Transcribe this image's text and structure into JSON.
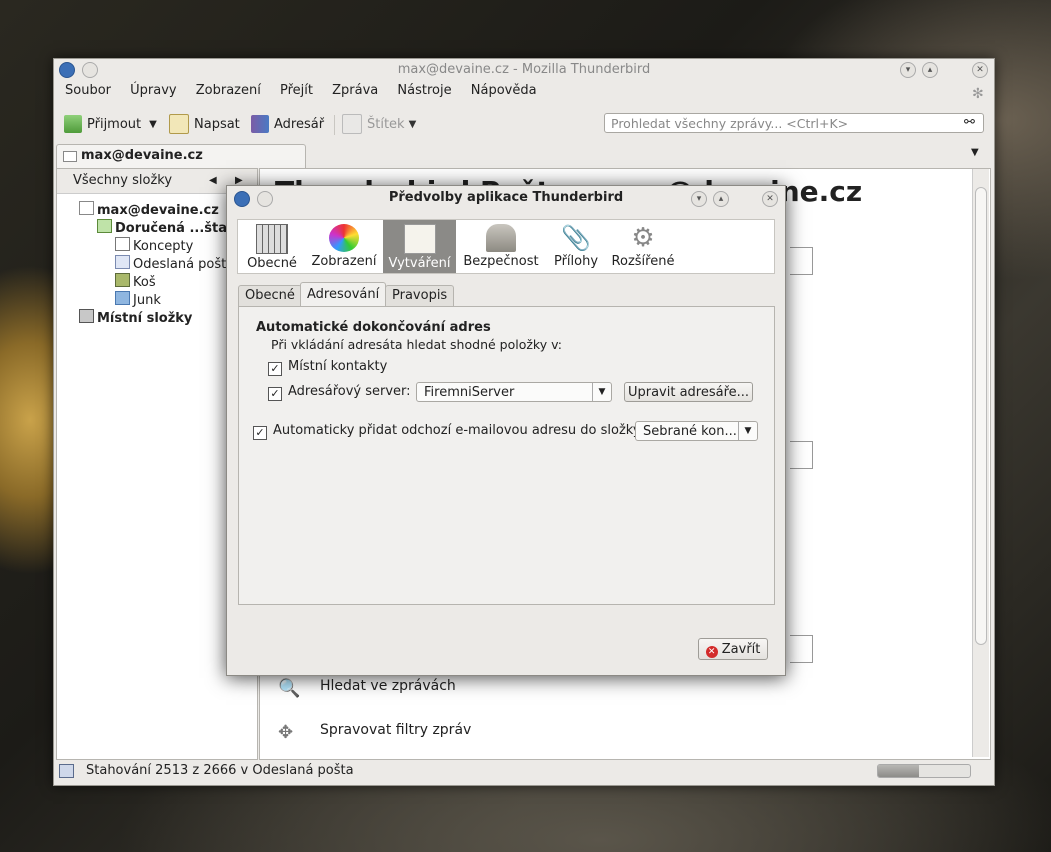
{
  "main_window": {
    "title": "max@devaine.cz - Mozilla Thunderbird",
    "menu": [
      "Soubor",
      "Úpravy",
      "Zobrazení",
      "Přejít",
      "Zpráva",
      "Nástroje",
      "Nápověda"
    ],
    "toolbar": {
      "get_mail": "Přijmout",
      "write": "Napsat",
      "address_book": "Adresář",
      "tag": "Štítek"
    },
    "search_placeholder": "Prohledat všechny zprávy... <Ctrl+K>",
    "account_tab": "max@devaine.cz",
    "folder_header": "Všechny složky",
    "folders": {
      "account": "max@devaine.cz",
      "inbox": "Doručená ...šta (",
      "drafts": "Koncepty",
      "sent": "Odeslaná pošta",
      "trash": "Koš",
      "junk": "Junk",
      "local": "Místní složky"
    },
    "content_title": "Thunderbird Pošta - max@devaine.cz",
    "actions": {
      "search": "Hledat ve zprávách",
      "filters": "Spravovat filtry zpráv"
    },
    "status": "Stahování 2513 z 2666 v Odeslaná pošta",
    "progress_fraction": 0.45
  },
  "dialog": {
    "title": "Předvolby aplikace Thunderbird",
    "panes": [
      "Obecné",
      "Zobrazení",
      "Vytváření",
      "Bezpečnost",
      "Přílohy",
      "Rozšířené"
    ],
    "selected_pane": "Vytváření",
    "subtabs": [
      "Obecné",
      "Adresování",
      "Pravopis"
    ],
    "selected_subtab": "Adresování",
    "section_title": "Automatické dokončování adres",
    "section_desc": "Při vkládání adresáta hledat shodné položky v:",
    "local_contacts": "Místní kontakty",
    "directory_server": "Adresářový server:",
    "server_value": "FiremniServer",
    "edit_directories": "Upravit adresáře...",
    "auto_add_label": "Automaticky přidat odchozí e-mailovou adresu do složky:",
    "auto_add_value": "Sebrané kon...",
    "close_button": "Zavřít"
  }
}
